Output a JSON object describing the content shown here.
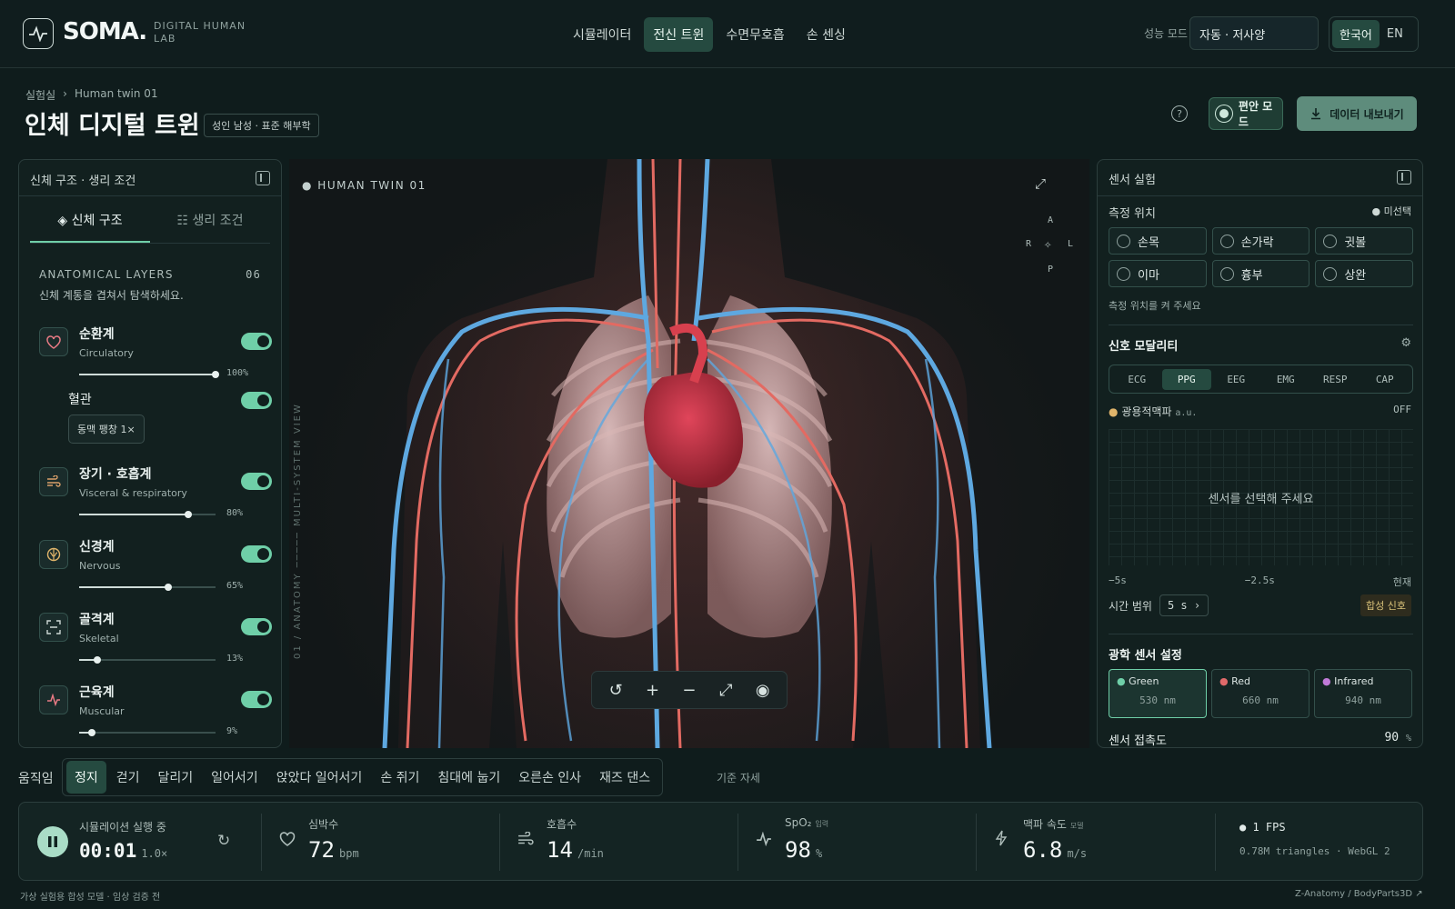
{
  "header": {
    "logo": "SOMA.",
    "logo_sub": "DIGITAL HUMAN LAB",
    "nav": [
      {
        "label": "시뮬레이터"
      },
      {
        "label": "전신 트윈"
      },
      {
        "label": "수면무호흡"
      },
      {
        "label": "손 센싱"
      }
    ],
    "active_nav": "전신 트윈",
    "perf_label": "성능 모드",
    "perf_value": "자동 · 저사양",
    "lang": [
      "한국어",
      "EN"
    ],
    "active_lang": "한국어"
  },
  "title_area": {
    "breadcrumb": [
      "실험실",
      "Human twin 01"
    ],
    "breadcrumb_sep": "›",
    "title": "인체 디지털 트윈",
    "tag": "성인 남성 · 표준 해부학",
    "help_icon": "?",
    "comfort_mode": "편안 모드",
    "export": "데이터 내보내기"
  },
  "left_panel": {
    "header": "신체 구조 · 생리 조건",
    "tabs": [
      "신체 구조",
      "생리 조건"
    ],
    "active_tab": "신체 구조",
    "section_title": "ANATOMICAL LAYERS",
    "section_count": "06",
    "section_desc": "신체 계통을 겹쳐서 탐색하세요.",
    "layers": [
      {
        "name": "순환계",
        "sub": "Circulatory",
        "value": 100,
        "pct": "100%",
        "icon": "heart-icon",
        "on": true
      },
      {
        "name": "장기 · 호흡계",
        "sub": "Visceral & respiratory",
        "value": 80,
        "pct": "80%",
        "icon": "wind-icon",
        "on": true
      },
      {
        "name": "신경계",
        "sub": "Nervous",
        "value": 65,
        "pct": "65%",
        "icon": "brain-icon",
        "on": true
      },
      {
        "name": "골격계",
        "sub": "Skeletal",
        "value": 13,
        "pct": "13%",
        "icon": "scan-icon",
        "on": true
      },
      {
        "name": "근육계",
        "sub": "Muscular",
        "value": 9,
        "pct": "9%",
        "icon": "pulse-icon",
        "on": true
      }
    ],
    "vessels": {
      "name": "혈관",
      "chip": "동맥 팽창 1×",
      "on": true
    }
  },
  "viewport": {
    "label": "HUMAN TWIN 01",
    "side_label": "01 / ANATOMY ───── MULTI-SYSTEM VIEW",
    "orient": {
      "a": "A",
      "p": "P",
      "r": "R",
      "l": "L"
    }
  },
  "right_panel": {
    "header": "센서 실험",
    "loc_title": "측정 위치",
    "loc_status": "미선택",
    "locations": [
      "손목",
      "손가락",
      "귓볼",
      "이마",
      "흉부",
      "상완"
    ],
    "loc_hint": "측정 위치를 켜 주세요",
    "modality_title": "신호 모달리티",
    "modalities": [
      "ECG",
      "PPG",
      "EEG",
      "EMG",
      "RESP",
      "CAP"
    ],
    "active_modality": "PPG",
    "signal_name": "광용적맥파",
    "signal_unit": "a.u.",
    "signal_state": "OFF",
    "plot_empty": "센서를 선택해 주세요",
    "x_ticks": [
      "−5s",
      "−2.5s",
      "현재"
    ],
    "time_range_label": "시간 범위",
    "time_range_value": "5 s",
    "synthetic": "합성 신호",
    "optical_title": "광학 센서 설정",
    "optical": [
      {
        "name": "Green",
        "wl": "530 nm",
        "color": "#6fcfa8"
      },
      {
        "name": "Red",
        "wl": "660 nm",
        "color": "#e06a6a"
      },
      {
        "name": "Infrared",
        "wl": "940 nm",
        "color": "#c07ad8"
      }
    ],
    "contact_label": "센서 접촉도",
    "contact_value": "90",
    "contact_unit": "%"
  },
  "motion": {
    "label": "움직임",
    "items": [
      "정지",
      "걷기",
      "달리기",
      "일어서기",
      "앉았다 일어서기",
      "손 쥐기",
      "침대에 눕기",
      "오른손 인사",
      "재즈 댄스"
    ],
    "active": "정지",
    "base_pose": "기준 자세"
  },
  "status": {
    "sim_label": "시뮬레이션 실행 중",
    "time": "00:01",
    "speed": "1.0×",
    "metrics": [
      {
        "label": "심박수",
        "value": "72",
        "unit": "bpm",
        "tag": "",
        "icon": "heart-icon"
      },
      {
        "label": "호흡수",
        "value": "14",
        "unit": "/min",
        "tag": "",
        "icon": "wind-icon"
      },
      {
        "label": "SpO₂",
        "value": "98",
        "unit": "%",
        "tag": "입력",
        "icon": "pulse-icon"
      },
      {
        "label": "맥파 속도",
        "value": "6.8",
        "unit": "m/s",
        "tag": "모델",
        "icon": "bolt-icon"
      }
    ],
    "fps": "1 FPS",
    "render": "0.78M triangles · WebGL 2"
  },
  "footer": {
    "left": "가상 실험용 합성 모델 · 임상 검증 전",
    "right": "Z-Anatomy / BodyParts3D ↗"
  },
  "colors": {
    "accent": "#6fcfa8",
    "active_bg": "#254a40",
    "background": "#0f1c1c"
  }
}
